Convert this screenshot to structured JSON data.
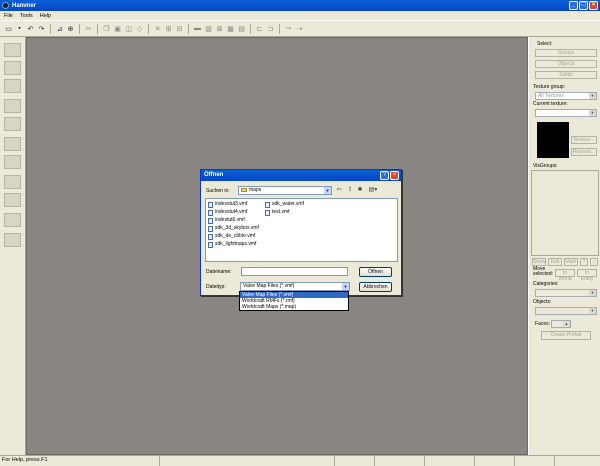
{
  "window": {
    "title": "Hammer"
  },
  "menu": [
    "File",
    "Tools",
    "Help"
  ],
  "toolbar": {
    "icons": [
      "open-icon",
      "save-icon",
      "undo-icon",
      "redo-icon",
      "cut-icon",
      "copy-icon",
      "paste-icon",
      "select-icon",
      "zoom-icon",
      "camera-icon",
      "entity-icon",
      "block-icon",
      "texture-icon",
      "decal-icon",
      "clip-icon",
      "vertex-icon",
      "path-icon",
      "group-icon",
      "ungroup-icon",
      "hide-icon",
      "carve-icon",
      "hollow-icon",
      "run-icon"
    ]
  },
  "right_panel": {
    "select_label": "Select:",
    "select_buttons": [
      "Groups",
      "Objects",
      "Solids"
    ],
    "texture_group_label": "Texture group:",
    "texture_group_value": "All Textures",
    "current_texture_label": "Current texture:",
    "browse_label": "Browse...",
    "replace_label": "Replace...",
    "visgroups_label": "VisGroups:",
    "visgroup_buttons": [
      "Show",
      "Edit",
      "Mark",
      "Purge"
    ],
    "move_selected_label": "Move selected:",
    "move_buttons": [
      "to World",
      "to Entity"
    ],
    "categories_label": "Categories:",
    "objects_label": "Objects:",
    "faces_label": "Faces:",
    "create_prefab_label": "Create Prefab"
  },
  "status": {
    "help_text": "For Help, press F1"
  },
  "dialog": {
    "title": "Öffnen",
    "look_in_label": "Suchen in:",
    "look_in_value": "maps",
    "files": [
      "indexstut3.vmf",
      "indexstut4.vmf",
      "indextut6.vmf",
      "sdk_3d_skybox.vmf",
      "sdk_de_cbble.vmf",
      "sdk_lightmaps.vmf",
      "sdk_water.vmf",
      "test.vmf"
    ],
    "filename_label": "Dateiname:",
    "filename_value": "",
    "filetype_label": "Dateityp:",
    "filetype_value": "Valve Map Files (*.vmf)",
    "open_button": "Öffnen",
    "cancel_button": "Abbrechen",
    "filetype_options": [
      "Valve Map Files (*.vmf)",
      "Worldcraft RMFs (*.rmf)",
      "Worldcraft Maps (*.map)"
    ],
    "selected_option_index": 0
  }
}
